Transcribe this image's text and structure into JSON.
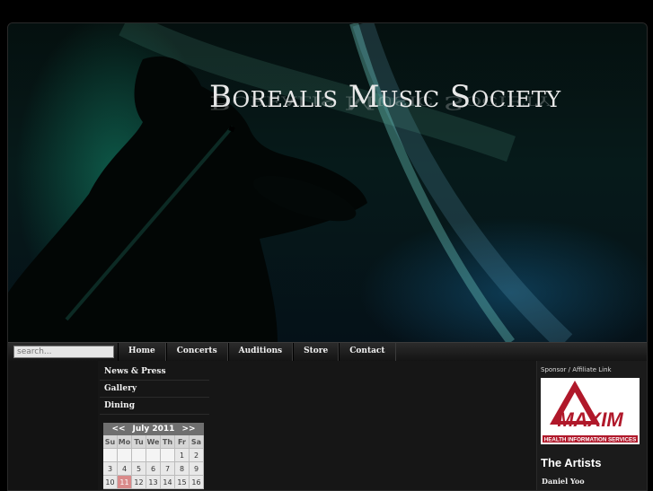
{
  "header": {
    "title": "Borealis Music Society"
  },
  "search": {
    "placeholder": "search..."
  },
  "nav": {
    "items": [
      "Home",
      "Concerts",
      "Auditions",
      "Store",
      "Contact"
    ]
  },
  "sidebar": {
    "items": [
      "News & Press",
      "Gallery",
      "Dining"
    ]
  },
  "calendar": {
    "prev": "<<",
    "month_label": "July 2011",
    "next": ">>",
    "weekdays": [
      "Su",
      "Mo",
      "Tu",
      "We",
      "Th",
      "Fr",
      "Sa"
    ],
    "weeks": [
      [
        "",
        "",
        "",
        "",
        "",
        "1",
        "2"
      ],
      [
        "3",
        "4",
        "5",
        "6",
        "7",
        "8",
        "9"
      ],
      [
        "10",
        "11",
        "12",
        "13",
        "14",
        "15",
        "16"
      ]
    ],
    "today": "11"
  },
  "sponsor": {
    "label": "Sponsor / Affiliate Link",
    "logo_text": "MAXIM",
    "logo_tagline": "HEALTH INFORMATION SERVICES"
  },
  "artists": {
    "heading": "The Artists",
    "names": [
      "Daniel Yoo"
    ]
  },
  "colors": {
    "background": "#000000",
    "nav_bar": "#1e1e1e",
    "calendar_today": "#d98a8a",
    "sponsor_brand": "#b0182a"
  }
}
